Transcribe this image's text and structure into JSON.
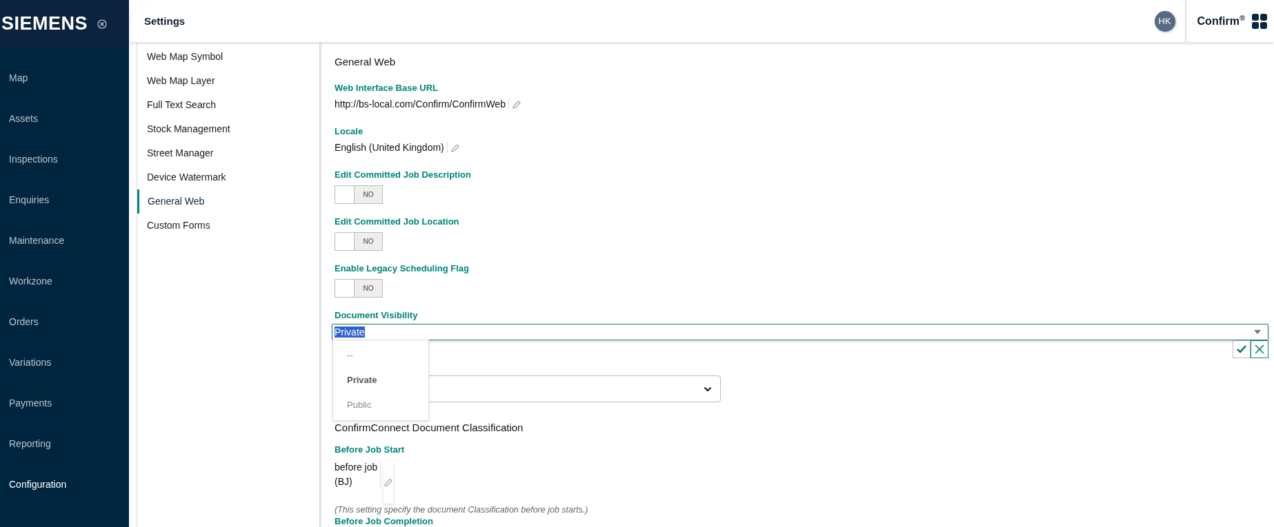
{
  "brand": {
    "logo": "SIEMENS",
    "app_name": "Confirm",
    "app_mark": "®"
  },
  "header": {
    "title": "Settings",
    "avatar": "HK"
  },
  "nav": [
    {
      "label": "Map",
      "selected": false
    },
    {
      "label": "Assets",
      "selected": false
    },
    {
      "label": "Inspections",
      "selected": false
    },
    {
      "label": "Enquiries",
      "selected": false
    },
    {
      "label": "Maintenance",
      "selected": false
    },
    {
      "label": "Workzone",
      "selected": false
    },
    {
      "label": "Orders",
      "selected": false
    },
    {
      "label": "Variations",
      "selected": false
    },
    {
      "label": "Payments",
      "selected": false
    },
    {
      "label": "Reporting",
      "selected": false
    },
    {
      "label": "Configuration",
      "selected": true
    }
  ],
  "settings_menu": [
    {
      "label": "Web Map Symbol",
      "selected": false
    },
    {
      "label": "Web Map Layer",
      "selected": false
    },
    {
      "label": "Full Text Search",
      "selected": false
    },
    {
      "label": "Stock Management",
      "selected": false
    },
    {
      "label": "Street Manager",
      "selected": false
    },
    {
      "label": "Device Watermark",
      "selected": false
    },
    {
      "label": "General Web",
      "selected": true
    },
    {
      "label": "Custom Forms",
      "selected": false
    }
  ],
  "section_title": "General Web",
  "fields": [
    {
      "kind": "text",
      "label": "Web Interface Base URL",
      "value": "http://bs-local.com/Confirm/ConfirmWeb"
    },
    {
      "kind": "text",
      "label": "Locale",
      "value": "English (United Kingdom)"
    },
    {
      "kind": "toggle",
      "label": "Edit Committed Job Description",
      "checked": false,
      "state_text": "NO"
    },
    {
      "kind": "toggle",
      "label": "Edit Committed Job Location",
      "checked": false,
      "state_text": "NO"
    },
    {
      "kind": "toggle",
      "label": "Enable Legacy Scheduling Flag",
      "checked": false,
      "state_text": "NO"
    }
  ],
  "document_visibility": {
    "label": "Document Visibility",
    "value": "Private",
    "options": [
      {
        "label": "--",
        "selected": false
      },
      {
        "label": "Private",
        "selected": true
      },
      {
        "label": "Public",
        "selected": false
      }
    ]
  },
  "section2_title": "ConfirmConnect Document Classification",
  "before_job_start": {
    "label": "Before Job Start",
    "value_lines": [
      "before job",
      "(BJ)"
    ],
    "note": "(This setting specify the document Classification before job starts.)"
  },
  "next_label": "Before Job Completion"
}
